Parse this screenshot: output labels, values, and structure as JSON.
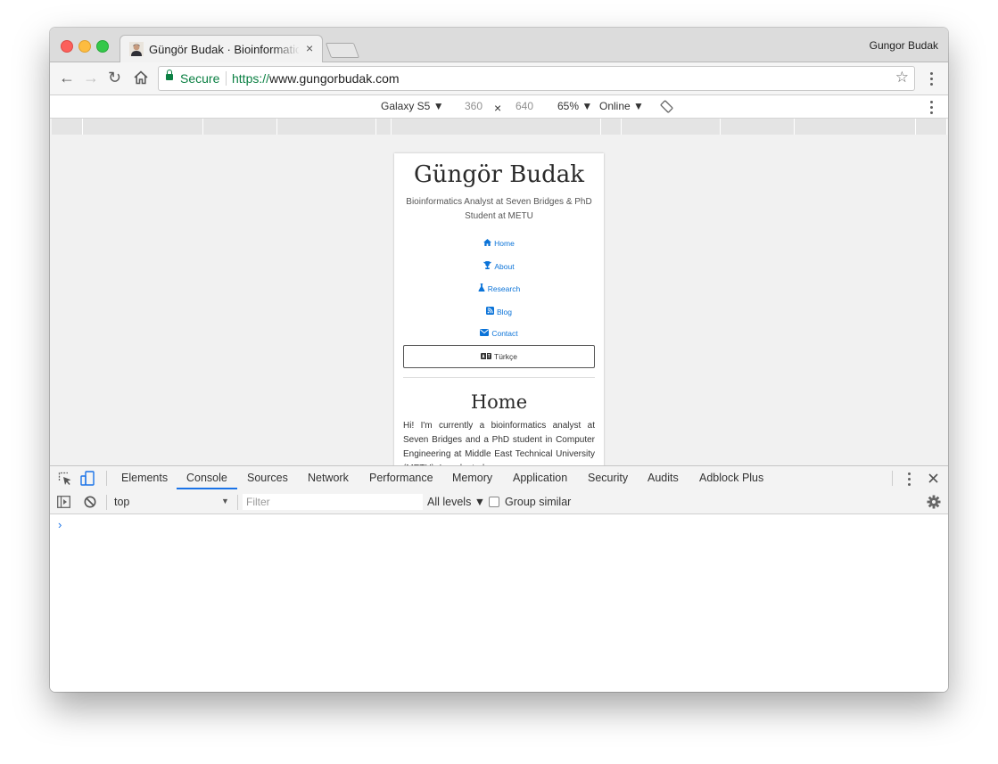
{
  "browser": {
    "tab_title": "Güngör Budak · Bioinformatics",
    "tab_close": "×",
    "profile_name": "Gungor Budak",
    "secure_label": "Secure",
    "url_scheme": "https://",
    "url_host": "www.gungorbudak.com"
  },
  "device_toolbar": {
    "device": "Galaxy S5 ▼",
    "width": "360",
    "times": "×",
    "height": "640",
    "zoom": "65% ▼",
    "network": "Online ▼"
  },
  "site": {
    "title": "Güngör Budak",
    "subtitle": "Bioinformatics Analyst at Seven Bridges & PhD Student at METU",
    "nav": [
      {
        "icon": "home-icon",
        "label": "Home"
      },
      {
        "icon": "trophy-icon",
        "label": "About"
      },
      {
        "icon": "flask-icon",
        "label": "Research"
      },
      {
        "icon": "rss-icon",
        "label": "Blog"
      },
      {
        "icon": "envelope-icon",
        "label": "Contact"
      }
    ],
    "language_button": "Türkçe",
    "section_heading": "Home",
    "intro": "Hi! I'm currently a bioinformatics analyst at Seven Bridges and a PhD student in Computer Engineering at Middle East Technical University (METU). I graduated"
  },
  "devtools": {
    "tabs": [
      "Elements",
      "Console",
      "Sources",
      "Network",
      "Performance",
      "Memory",
      "Application",
      "Security",
      "Audits",
      "Adblock Plus"
    ],
    "active_tab": "Console",
    "context": "top",
    "filter_placeholder": "Filter",
    "levels": "All levels ▼",
    "group_similar": "Group similar",
    "prompt": "›"
  },
  "colors": {
    "link": "#0b73d8",
    "secure": "#0b8043",
    "devtools_accent": "#1a73e8"
  }
}
